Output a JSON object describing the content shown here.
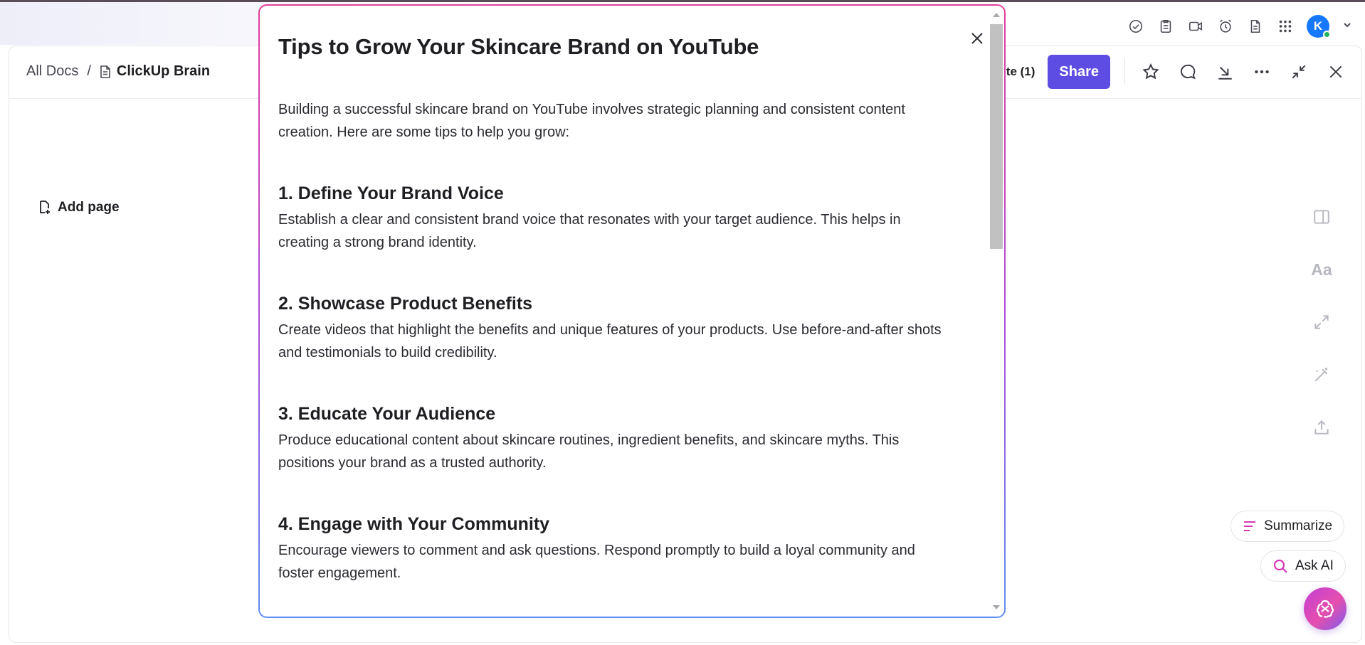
{
  "topbar": {
    "icons": [
      "check-circle-icon",
      "clipboard-icon",
      "video-icon",
      "alarm-icon",
      "document-icon",
      "apps-grid-icon"
    ],
    "avatar_initial": "K"
  },
  "header": {
    "breadcrumb_root": "All Docs",
    "breadcrumb_separator": "/",
    "breadcrumb_doc": "ClickUp Brain",
    "update_label": "te (1)",
    "share_label": "Share"
  },
  "sidebar": {
    "add_page_label": "Add page"
  },
  "side_tools": {
    "font_label": "Aa"
  },
  "ai_actions": {
    "summarize_label": "Summarize",
    "ask_ai_label": "Ask AI"
  },
  "modal": {
    "title": "Tips to Grow Your Skincare Brand on YouTube",
    "intro": "Building a successful skincare brand on YouTube involves strategic planning and consistent content creation. Here are some tips to help you grow:",
    "tips": [
      {
        "heading": "1. Define Your Brand Voice",
        "body": "Establish a clear and consistent brand voice that resonates with your target audience. This helps in creating a strong brand identity."
      },
      {
        "heading": "2. Showcase Product Benefits",
        "body": "Create videos that highlight the benefits and unique features of your products. Use before-and-after shots and testimonials to build credibility."
      },
      {
        "heading": "3. Educate Your Audience",
        "body": "Produce educational content about skincare routines, ingredient benefits, and skincare myths. This positions your brand as a trusted authority."
      },
      {
        "heading": "4. Engage with Your Community",
        "body": "Encourage viewers to comment and ask questions. Respond promptly to build a loyal community and foster engagement."
      }
    ]
  },
  "colors": {
    "share_button": "#5d4de2",
    "avatar": "#1677ff",
    "ai_accent": "#d63ab8"
  }
}
